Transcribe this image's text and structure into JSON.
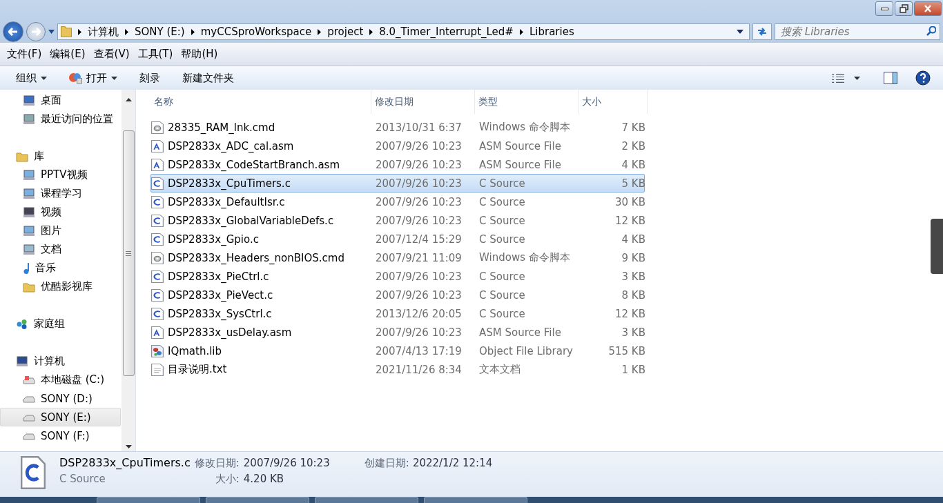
{
  "address": {
    "crumbs": [
      "计算机",
      "SONY (E:)",
      "myCCSproWorkspace",
      "project",
      "8.0_Timer_Interrupt_Led#",
      "Libraries"
    ]
  },
  "search": {
    "placeholder": "搜索 Libraries"
  },
  "menu": [
    "文件(F)",
    "编辑(E)",
    "查看(V)",
    "工具(T)",
    "帮助(H)"
  ],
  "toolbar": [
    {
      "label": "组织",
      "dropdown": true
    },
    {
      "label": "打开",
      "dropdown": true
    },
    {
      "label": "刻录",
      "dropdown": false
    },
    {
      "label": "新建文件夹",
      "dropdown": false
    }
  ],
  "sidebar": {
    "groups": [
      {
        "children": [
          {
            "label": "桌面",
            "selected": false
          },
          {
            "label": "最近访问的位置",
            "selected": false
          }
        ]
      },
      {
        "label": "库",
        "children": [
          {
            "label": "PPTV视频",
            "selected": false
          },
          {
            "label": "课程学习",
            "selected": false
          },
          {
            "label": "视频",
            "selected": false
          },
          {
            "label": "图片",
            "selected": false
          },
          {
            "label": "文档",
            "selected": false
          },
          {
            "label": "音乐",
            "selected": false
          },
          {
            "label": "优酷影视库",
            "selected": false
          }
        ]
      },
      {
        "label": "家庭组"
      },
      {
        "label": "计算机",
        "children": [
          {
            "label": "本地磁盘 (C:)",
            "selected": false
          },
          {
            "label": "SONY (D:)",
            "selected": false
          },
          {
            "label": "SONY (E:)",
            "selected": true
          },
          {
            "label": "SONY (F:)",
            "selected": false
          }
        ]
      }
    ]
  },
  "table": {
    "columns": [
      "名称",
      "修改日期",
      "类型",
      "大小"
    ],
    "rows": [
      {
        "kind": "cmd",
        "name": "28335_RAM_lnk.cmd",
        "date": "2013/10/31 6:37",
        "type": "Windows 命令脚本",
        "size": "7 KB",
        "selected": false
      },
      {
        "kind": "asm",
        "name": "DSP2833x_ADC_cal.asm",
        "date": "2007/9/26 10:23",
        "type": "ASM Source File",
        "size": "2 KB",
        "selected": false
      },
      {
        "kind": "asm",
        "name": "DSP2833x_CodeStartBranch.asm",
        "date": "2007/9/26 10:23",
        "type": "ASM Source File",
        "size": "4 KB",
        "selected": false
      },
      {
        "kind": "c",
        "name": "DSP2833x_CpuTimers.c",
        "date": "2007/9/26 10:23",
        "type": "C Source",
        "size": "5 KB",
        "selected": true
      },
      {
        "kind": "c",
        "name": "DSP2833x_DefaultIsr.c",
        "date": "2007/9/26 10:23",
        "type": "C Source",
        "size": "30 KB",
        "selected": false
      },
      {
        "kind": "c",
        "name": "DSP2833x_GlobalVariableDefs.c",
        "date": "2007/9/26 10:23",
        "type": "C Source",
        "size": "12 KB",
        "selected": false
      },
      {
        "kind": "c",
        "name": "DSP2833x_Gpio.c",
        "date": "2007/12/4 15:29",
        "type": "C Source",
        "size": "4 KB",
        "selected": false
      },
      {
        "kind": "cmd",
        "name": "DSP2833x_Headers_nonBIOS.cmd",
        "date": "2007/9/21 11:09",
        "type": "Windows 命令脚本",
        "size": "9 KB",
        "selected": false
      },
      {
        "kind": "c",
        "name": "DSP2833x_PieCtrl.c",
        "date": "2007/9/26 10:23",
        "type": "C Source",
        "size": "3 KB",
        "selected": false
      },
      {
        "kind": "c",
        "name": "DSP2833x_PieVect.c",
        "date": "2007/9/26 10:23",
        "type": "C Source",
        "size": "8 KB",
        "selected": false
      },
      {
        "kind": "c",
        "name": "DSP2833x_SysCtrl.c",
        "date": "2013/12/6 20:05",
        "type": "C Source",
        "size": "12 KB",
        "selected": false
      },
      {
        "kind": "asm",
        "name": "DSP2833x_usDelay.asm",
        "date": "2007/9/26 10:23",
        "type": "ASM Source File",
        "size": "3 KB",
        "selected": false
      },
      {
        "kind": "lib",
        "name": "IQmath.lib",
        "date": "2007/4/13 17:19",
        "type": "Object File Library",
        "size": "515 KB",
        "selected": false
      },
      {
        "kind": "txt",
        "name": "目录说明.txt",
        "date": "2021/11/26 8:34",
        "type": "文本文档",
        "size": "1 KB",
        "selected": false
      }
    ]
  },
  "details": {
    "name": "DSP2833x_CpuTimers.c",
    "type": "C Source",
    "fields": [
      {
        "label": "修改日期:",
        "value": "2007/9/26 10:23"
      },
      {
        "label": "创建日期:",
        "value": "2022/1/2 12:14"
      },
      {
        "label": "大小:",
        "value": "4.20 KB"
      }
    ]
  }
}
